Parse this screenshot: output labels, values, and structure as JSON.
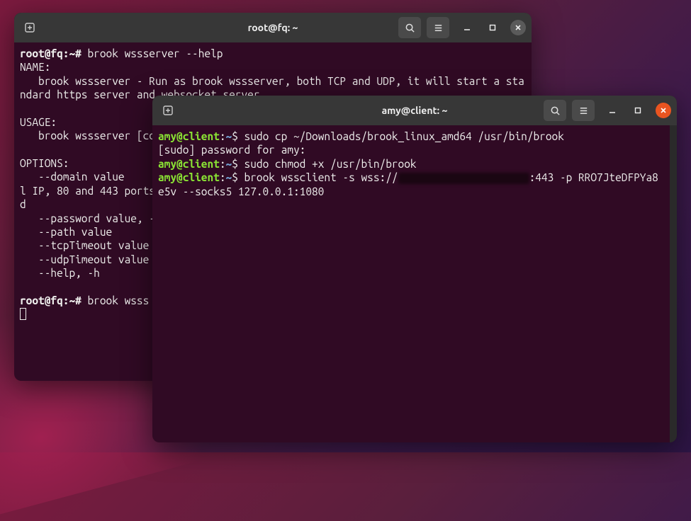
{
  "windows": {
    "back": {
      "title": "root@fq: ~",
      "lines": {
        "l1_prompt": "root@fq:~#",
        "l1_cmd": " brook wssserver --help",
        "l2": "NAME:",
        "l3": "   brook wssserver - Run as brook wssserver, both TCP and UDP, it will start a standard https server and websocket server",
        "l4": "",
        "l5": "USAGE:",
        "l6": "   brook wssserver [co",
        "l7": "",
        "l8": "OPTIONS:",
        "l9": "   --domain value",
        "l10": "l IP, 80 and 443 ports",
        "l11": "d",
        "l12": "   --password value, -",
        "l13": "   --path value",
        "l14": "   --tcpTimeout value",
        "l15": "   --udpTimeout value",
        "l16": "   --help, -h",
        "l17": "",
        "l18_prompt": "root@fq:~#",
        "l18_cmd": " brook wsss"
      }
    },
    "front": {
      "title": "amy@client: ~",
      "prompt_user": "amy@client",
      "prompt_path": "~",
      "lines": {
        "c1": " sudo cp ~/Downloads/brook_linux_amd64 /usr/bin/brook",
        "c2": "[sudo] password for amy:",
        "c3": " sudo chmod +x /usr/bin/brook",
        "c4a": " brook wssclient -s wss://",
        "c4b": ":443 -p RRO7JteDFPYa8e5v --socks5 127.0.0.1:1080"
      }
    }
  },
  "icons": {
    "new_tab": "new-tab-icon",
    "search": "search-icon",
    "menu": "hamburger-icon",
    "minimize": "minimize-icon",
    "maximize": "maximize-icon",
    "close": "close-icon"
  }
}
